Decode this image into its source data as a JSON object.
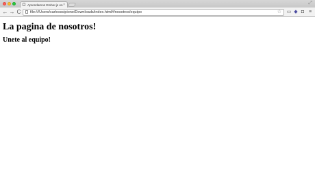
{
  "browser": {
    "tab": {
      "title": "Aprendamos Ember.js en",
      "close_glyph": "×"
    },
    "toolbar": {
      "back_glyph": "←",
      "forward_glyph": "→",
      "reload_glyph": "C",
      "url": "file:///Users/carlosscipione/Downloads/index.html#/nosotros/equipo",
      "star_glyph": "☆",
      "menu_glyph": "≡"
    },
    "icons": {
      "window_controls": [
        "close-icon",
        "minimize-icon",
        "maximize-icon"
      ],
      "fullscreen": "expand-icon",
      "extensions": [
        "cast-icon",
        "extension-icon",
        "pocket-icon"
      ]
    }
  },
  "page": {
    "title": "La pagina de nosotros!",
    "subtitle": "Unete al equipo!"
  }
}
